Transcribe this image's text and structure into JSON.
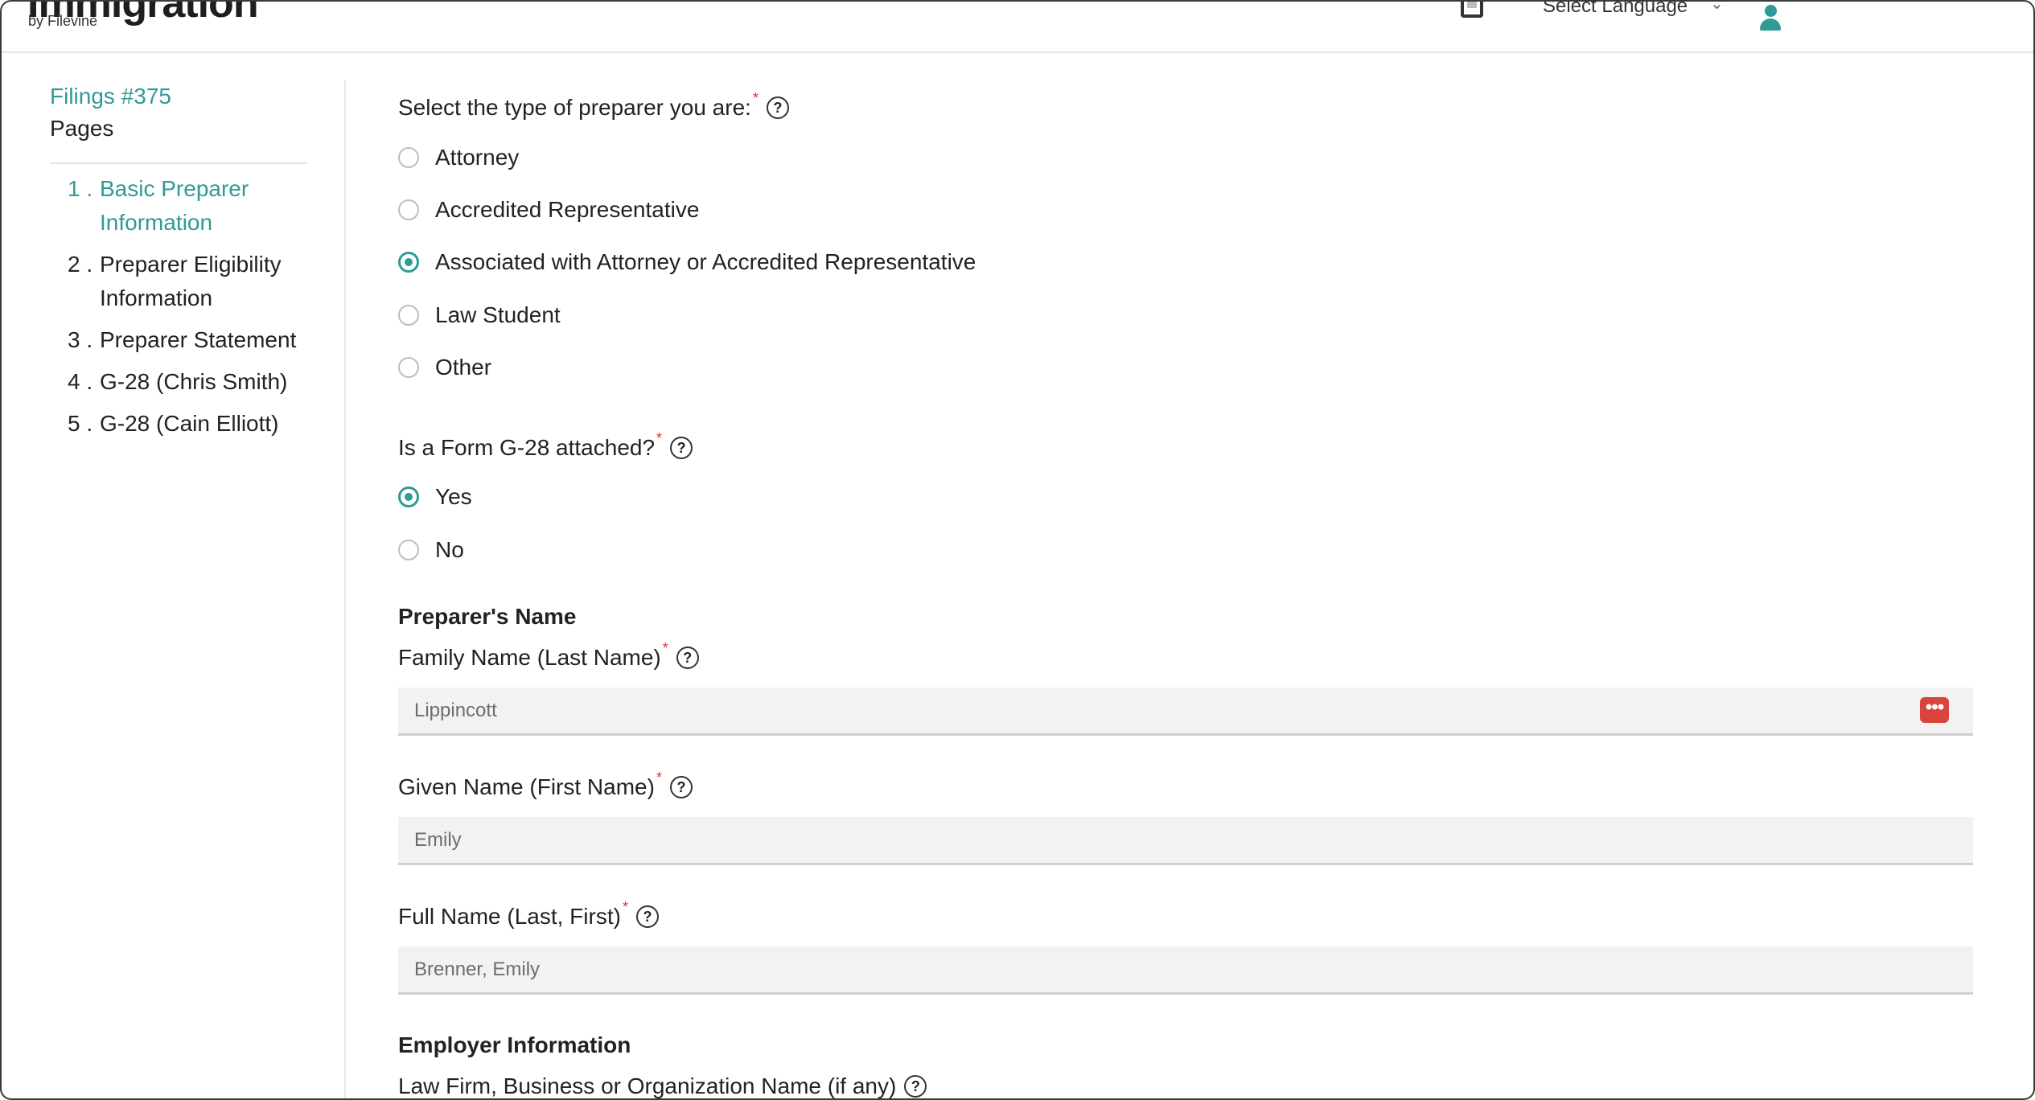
{
  "header": {
    "logo_main": "Immigration",
    "logo_sub": "by Filevine",
    "language_label": "Select Language",
    "icons": [
      "notes-icon",
      "chevron-down-icon",
      "user-icon"
    ]
  },
  "sidebar": {
    "filing_title": "Filings #375",
    "pages_label": "Pages",
    "items": [
      {
        "num": "1 .",
        "label": "Basic Preparer Information"
      },
      {
        "num": "2 .",
        "label": "Preparer Eligibility Information"
      },
      {
        "num": "3 .",
        "label": "Preparer Statement"
      },
      {
        "num": "4 .",
        "label": "G-28 (Chris Smith)"
      },
      {
        "num": "5 .",
        "label": "G-28 (Cain Elliott)"
      }
    ],
    "active_index": 0
  },
  "form": {
    "preparer_type": {
      "question": "Select the type of preparer you are:",
      "required": "*",
      "options": [
        "Attorney",
        "Accredited Representative",
        "Associated with Attorney or Accredited Representative",
        "Law Student",
        "Other"
      ],
      "selected": "Associated with Attorney or Accredited Representative"
    },
    "g28_attached": {
      "question": "Is a Form G-28 attached?",
      "required": "*",
      "options": [
        "Yes",
        "No"
      ],
      "selected": "Yes"
    },
    "preparer_name": {
      "section": "Preparer's Name",
      "family_name_label": "Family Name (Last Name)",
      "family_name_value": "Lippincott",
      "given_name_label": "Given Name (First Name)",
      "given_name_value": "Emily",
      "full_name_label": "Full Name (Last, First)",
      "full_name_value": "Brenner, Emily",
      "required": "*"
    },
    "employer": {
      "section": "Employer Information",
      "org_label": "Law Firm, Business or Organization Name (if any)"
    }
  },
  "colors": {
    "accent": "#2f9a96",
    "required": "#dd3333",
    "field_bg": "#f2f2f2",
    "action_button": "#d9443c"
  }
}
